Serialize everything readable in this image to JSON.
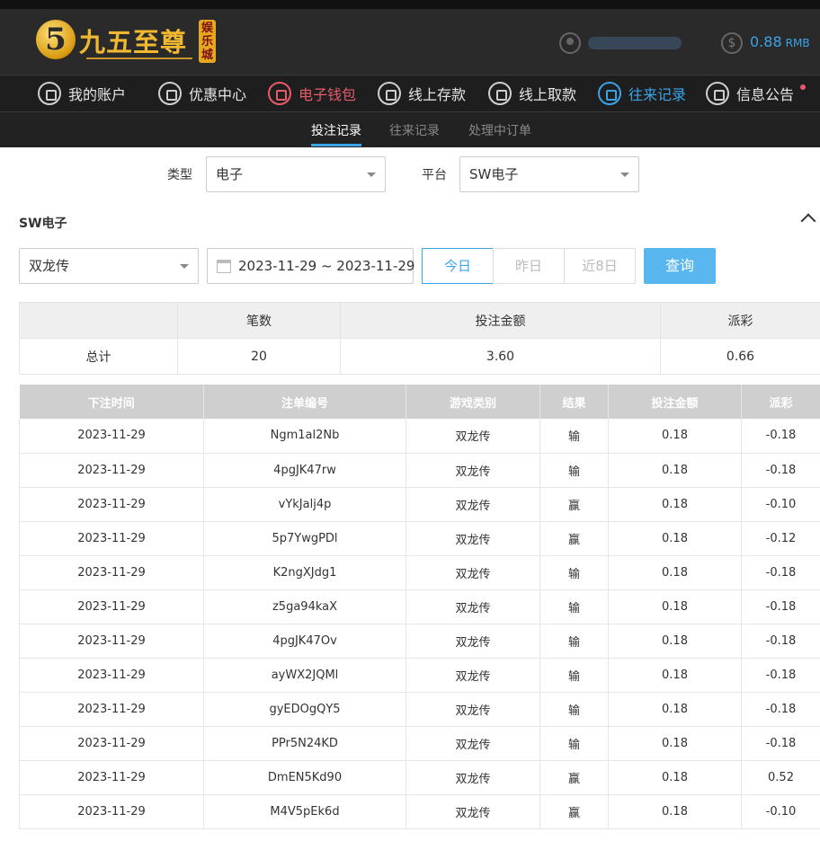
{
  "brand": {
    "digit": "5",
    "name": "九五至尊",
    "sub": "娱乐城"
  },
  "user": {
    "balance": "0.88",
    "unit": "RMB"
  },
  "nav": [
    {
      "label": "我的账户",
      "icon": "user-icon"
    },
    {
      "label": "优惠中心",
      "icon": "gift-icon"
    },
    {
      "label": "电子钱包",
      "icon": "wallet-icon"
    },
    {
      "label": "线上存款",
      "icon": "deposit-icon"
    },
    {
      "label": "线上取款",
      "icon": "withdraw-icon"
    },
    {
      "label": "往来记录",
      "icon": "records-icon"
    },
    {
      "label": "信息公告",
      "icon": "bell-icon"
    }
  ],
  "subtabs": [
    "投注记录",
    "往来记录",
    "处理中订单"
  ],
  "filters": {
    "type_label": "类型",
    "type_value": "电子",
    "platform_label": "平台",
    "platform_value": "SW电子"
  },
  "section_title": "SW电子",
  "game_select": "双龙传",
  "date_range": "2023-11-29 ~ 2023-11-29",
  "quick_dates": [
    "今日",
    "昨日",
    "近8日"
  ],
  "query_label": "查询",
  "summary": {
    "headers": [
      "",
      "笔数",
      "投注金额",
      "派彩"
    ],
    "row": [
      "总计",
      "20",
      "3.60",
      "0.66"
    ]
  },
  "records": {
    "headers": [
      "下注时间",
      "注单编号",
      "游戏类别",
      "结果",
      "投注金额",
      "派彩"
    ],
    "rows": [
      [
        "2023-11-29",
        "Ngm1al2Nb",
        "双龙传",
        "输",
        "0.18",
        "-0.18"
      ],
      [
        "2023-11-29",
        "4pgJK47rw",
        "双龙传",
        "输",
        "0.18",
        "-0.18"
      ],
      [
        "2023-11-29",
        "vYkJalj4p",
        "双龙传",
        "赢",
        "0.18",
        "-0.10"
      ],
      [
        "2023-11-29",
        "5p7YwgPDl",
        "双龙传",
        "赢",
        "0.18",
        "-0.12"
      ],
      [
        "2023-11-29",
        "K2ngXJdg1",
        "双龙传",
        "输",
        "0.18",
        "-0.18"
      ],
      [
        "2023-11-29",
        "z5ga94kaX",
        "双龙传",
        "输",
        "0.18",
        "-0.18"
      ],
      [
        "2023-11-29",
        "4pgJK47Ov",
        "双龙传",
        "输",
        "0.18",
        "-0.18"
      ],
      [
        "2023-11-29",
        "ayWX2JQMl",
        "双龙传",
        "输",
        "0.18",
        "-0.18"
      ],
      [
        "2023-11-29",
        "gyEDOgQY5",
        "双龙传",
        "输",
        "0.18",
        "-0.18"
      ],
      [
        "2023-11-29",
        "PPr5N24KD",
        "双龙传",
        "输",
        "0.18",
        "-0.18"
      ],
      [
        "2023-11-29",
        "DmEN5Kd90",
        "双龙传",
        "赢",
        "0.18",
        "0.52"
      ],
      [
        "2023-11-29",
        "M4V5pEk6d",
        "双龙传",
        "赢",
        "0.18",
        "-0.10"
      ]
    ]
  }
}
